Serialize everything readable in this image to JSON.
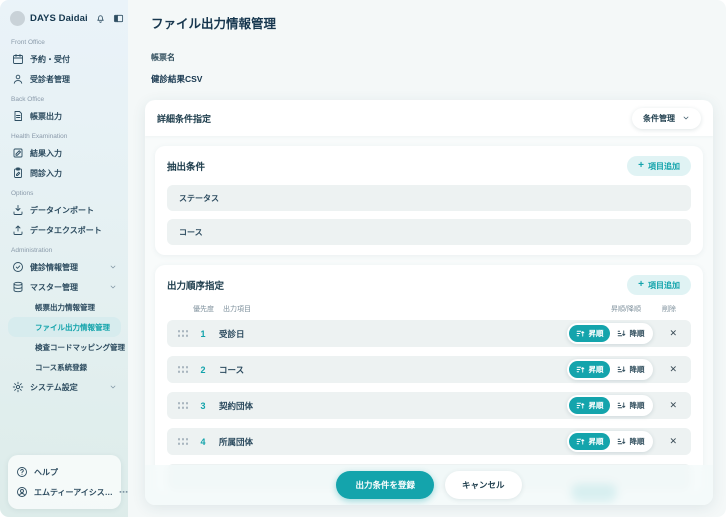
{
  "brand": {
    "name": "DAYS Daidai"
  },
  "sidebar": {
    "sections": {
      "front_office": "Front Office",
      "back_office": "Back Office",
      "health_examination": "Health Examination",
      "options": "Options",
      "administration": "Administration"
    },
    "items": {
      "reservation": "予約・受付",
      "patients": "受診者管理",
      "report_output": "帳票出力",
      "result_entry": "結果入力",
      "interview_entry": "問診入力",
      "data_import": "データインポート",
      "data_export": "データエクスポート",
      "checkup_info": "健診情報管理",
      "master_mgmt": "マスター管理",
      "sub_report_output_info": "帳票出力情報管理",
      "sub_file_output_info": "ファイル出力情報管理",
      "sub_code_mapping": "検査コードマッピング管理",
      "sub_course_registration": "コース系統登録",
      "system_settings": "システム設定",
      "help": "ヘルプ",
      "account": "エムティーアイシス…"
    }
  },
  "main": {
    "title": "ファイル出力情報管理",
    "report_name_label": "帳票名",
    "report_name_value": "健診結果CSV",
    "panel_header": "詳細条件指定",
    "condition_manage_button": "条件管理",
    "extract": {
      "title": "抽出条件",
      "add_button": "項目追加",
      "rows": [
        "ステータス",
        "コース"
      ]
    },
    "order": {
      "title": "出力順序指定",
      "add_button": "項目追加",
      "col_priority": "優先度",
      "col_item": "出力項目",
      "col_sort": "昇順/降順",
      "col_delete": "削除",
      "asc": "昇順",
      "desc": "降順",
      "delete_glyph": "✕",
      "rows": [
        {
          "priority": "1",
          "label": "受診日"
        },
        {
          "priority": "2",
          "label": "コース"
        },
        {
          "priority": "3",
          "label": "契約団体"
        },
        {
          "priority": "4",
          "label": "所属団体"
        }
      ]
    },
    "footer": {
      "submit": "出力条件を登録",
      "cancel": "キャンセル"
    }
  },
  "colors": {
    "accent": "#14a4ac",
    "accent_light": "#e0f3f4",
    "sidebar_active_bg": "#d7ecee",
    "text_dark": "#17374f"
  }
}
